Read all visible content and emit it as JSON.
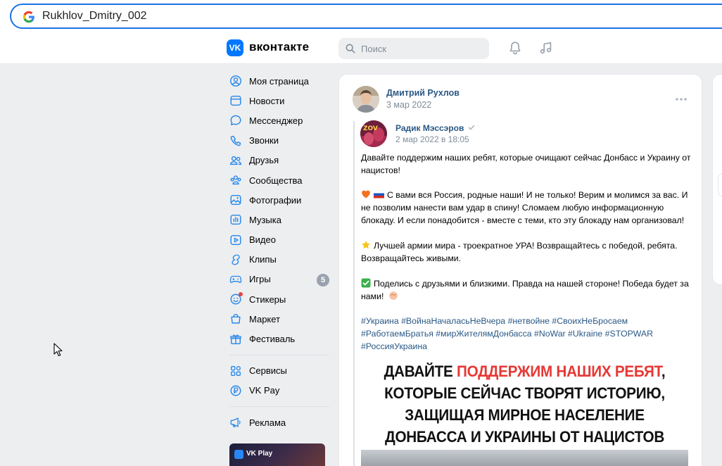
{
  "browser": {
    "address": "Rukhlov_Dmitry_002"
  },
  "header": {
    "logo_letters": "VK",
    "logo_text": "вконтакте",
    "search_placeholder": "Поиск"
  },
  "nav": {
    "items": [
      {
        "label": "Моя страница",
        "icon": "user-circle-icon"
      },
      {
        "label": "Новости",
        "icon": "newspaper-icon"
      },
      {
        "label": "Мессенджер",
        "icon": "chat-bubble-icon"
      },
      {
        "label": "Звонки",
        "icon": "phone-icon"
      },
      {
        "label": "Друзья",
        "icon": "users-icon"
      },
      {
        "label": "Сообщества",
        "icon": "community-icon"
      },
      {
        "label": "Фотографии",
        "icon": "photo-icon"
      },
      {
        "label": "Музыка",
        "icon": "music-bars-icon"
      },
      {
        "label": "Видео",
        "icon": "video-icon"
      },
      {
        "label": "Клипы",
        "icon": "clips-icon"
      },
      {
        "label": "Игры",
        "icon": "gamepad-icon",
        "badge": "5"
      },
      {
        "label": "Стикеры",
        "icon": "sticker-icon"
      },
      {
        "label": "Маркет",
        "icon": "shopping-bag-icon"
      },
      {
        "label": "Фестиваль",
        "icon": "gift-icon"
      }
    ],
    "items2": [
      {
        "label": "Сервисы",
        "icon": "services-grid-icon"
      },
      {
        "label": "VK Pay",
        "icon": "vkpay-icon"
      }
    ],
    "items3": [
      {
        "label": "Реклама",
        "icon": "megaphone-icon"
      }
    ],
    "promo": "VK Play"
  },
  "post": {
    "author": "Дмитрий Рухлов",
    "date": "3 мар 2022",
    "repost": {
      "author": "Радик Мэссэров",
      "date": "2 мар 2022 в 18:05",
      "avatar_text": "ZOV"
    },
    "p1": "Давайте поддержим наших ребят, которые очищают сейчас Донбасс и Украину от нацистов!",
    "p2": "С вами вся Россия, родные наши! И не только! Верим и молимся за вас. И не позволим нанести вам удар в спину! Сломаем любую информационную блокаду. И если понадобится - вместе с теми, кто эту блокаду нам организовал!",
    "p3": "Лучшей армии мира - троекратное УРА! Возвращайтесь с победой, ребята. Возвращайтесь живыми.",
    "p4": "Поделись с друзьями и близкими. Правда на нашей стороне! Победа будет за нами!",
    "hashtags": "#Украина #ВойнаНачаласьНеВчера #нетвойне #СвоихНеБросаем #РаботаемБратья #мирЖителямДонбасса #NoWar #Ukraine #STOPWAR #РоссияУкраина",
    "image": {
      "l1a": "ДАВАЙТЕ ",
      "l1b": "ПОДДЕРЖИМ НАШИХ РЕБЯТ",
      "l1c": ",",
      "l2": "КОТОРЫЕ СЕЙЧАС ТВОРЯТ ИСТОРИЮ,",
      "l3": "ЗАЩИЩАЯ МИРНОЕ НАСЕЛЕНИЕ",
      "l4": "ДОНБАССА И УКРАИНЫ ОТ НАЦИСТОВ"
    }
  },
  "colors": {
    "accent": "#2a5885",
    "vk_blue": "#0077ff",
    "bg": "#edeef0"
  }
}
